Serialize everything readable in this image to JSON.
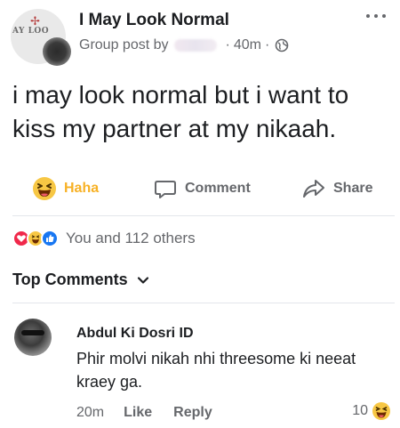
{
  "post": {
    "group_name": "I May Look Normal",
    "group_post_by_label": "Group post by",
    "time": "40m",
    "separator": "·",
    "text": "i may look normal but i want to kiss my partner at my nikaah.",
    "group_logo_text": "AY LOO"
  },
  "actions": {
    "haha_label": "Haha",
    "comment_label": "Comment",
    "share_label": "Share"
  },
  "reactions": {
    "summary_text": "You and 112 others",
    "icons": [
      "love-reaction-icon",
      "haha-reaction-icon",
      "like-reaction-icon"
    ]
  },
  "comments_section": {
    "title": "Top Comments"
  },
  "comment": {
    "author": "Abdul Ki Dosri ID",
    "text": "Phir molvi nikah nhi threesome ki neeat kraey ga.",
    "time": "20m",
    "like_label": "Like",
    "reply_label": "Reply",
    "reaction_count": "10"
  },
  "colors": {
    "haha_yellow": "#f7b125",
    "like_blue": "#1877f2",
    "love_red": "#f0284a",
    "secondary_text": "#65676b",
    "divider": "#e4e6eb"
  }
}
